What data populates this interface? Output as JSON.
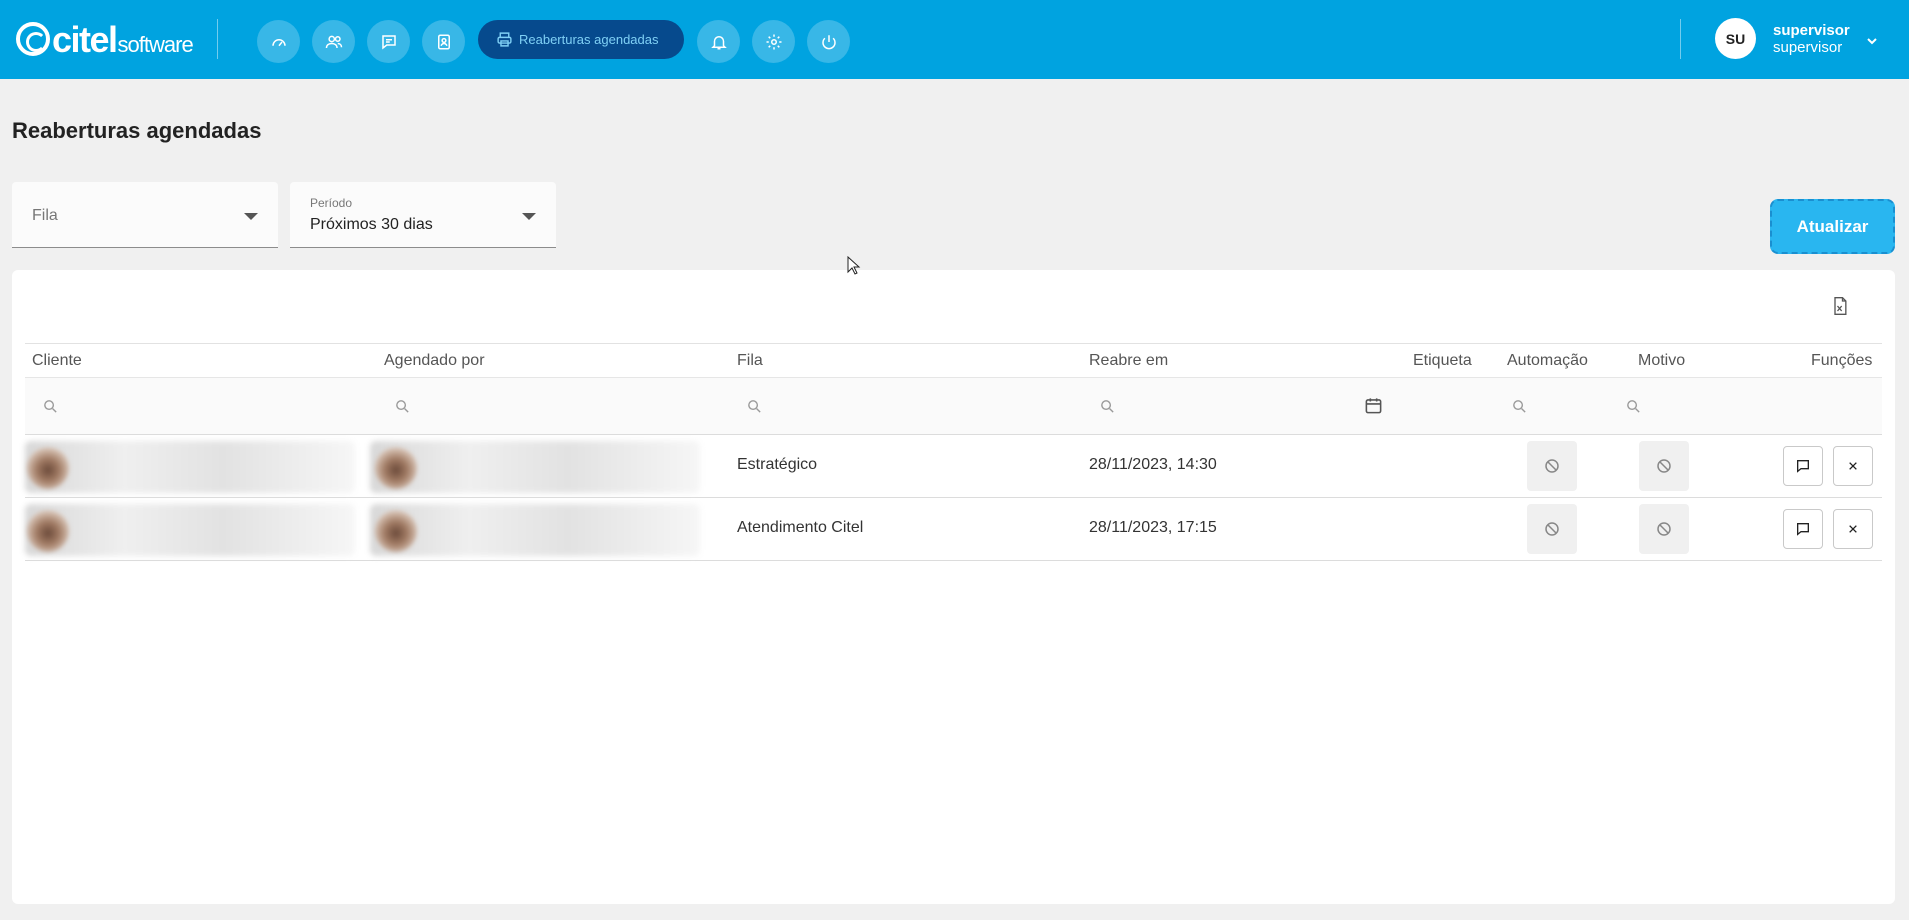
{
  "brand": {
    "name": "citel",
    "suffix": "software"
  },
  "nav": {
    "icons": [
      "dashboard-icon",
      "users-icon",
      "chat-icon",
      "contacts-icon",
      "printer-icon",
      "bell-icon",
      "gear-icon",
      "power-icon"
    ],
    "active_label": "Reaberturas agendadas"
  },
  "user": {
    "initials": "SU",
    "name": "supervisor",
    "role": "supervisor"
  },
  "page": {
    "title": "Reaberturas agendadas"
  },
  "filters": {
    "fila": {
      "placeholder": "Fila"
    },
    "periodo": {
      "label": "Período",
      "value": "Próximos 30 dias"
    }
  },
  "actions": {
    "refresh_label": "Atualizar"
  },
  "table": {
    "columns": [
      "Cliente",
      "Agendado por",
      "Fila",
      "Reabre em",
      "Etiqueta",
      "Automação",
      "Motivo",
      "Funções"
    ],
    "rows": [
      {
        "fila": "Estratégico",
        "reabre_em": "28/11/2023, 14:30"
      },
      {
        "fila": "Atendimento Citel",
        "reabre_em": "28/11/2023, 17:15"
      }
    ]
  },
  "colors": {
    "topbar": "#00a3e0",
    "active_nav": "#064a8d",
    "refresh_button": "#29b6f0"
  }
}
